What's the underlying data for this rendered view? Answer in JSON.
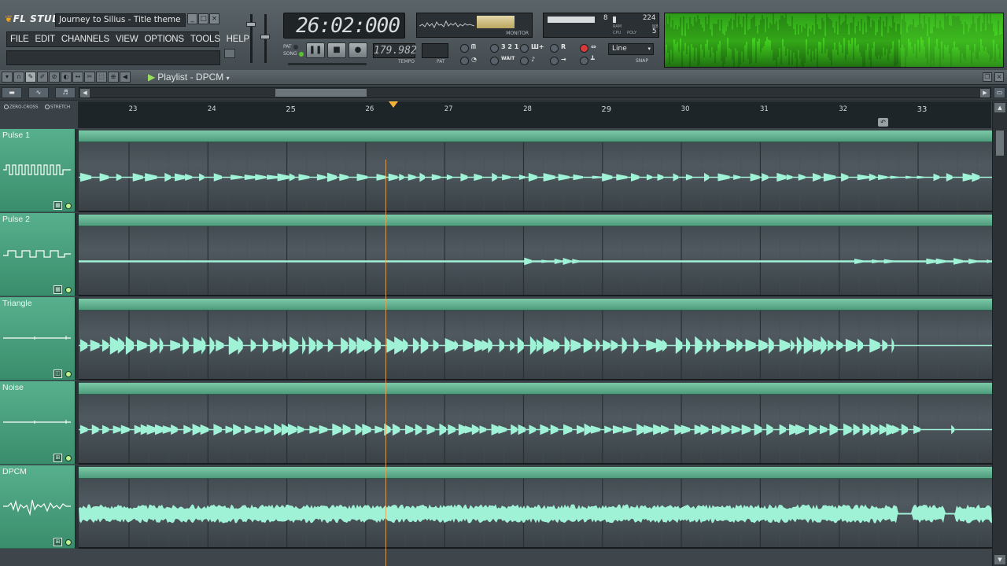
{
  "app": {
    "logo": "FL STUDIO",
    "song_title": "Journey to Silius - Title theme"
  },
  "menu": [
    "FILE",
    "EDIT",
    "CHANNELS",
    "VIEW",
    "OPTIONS",
    "TOOLS",
    "HELP"
  ],
  "window_buttons": [
    "_",
    "□",
    "×"
  ],
  "transport": {
    "time": "26:02:000",
    "pat_label": "PAT",
    "song_label": "SONG",
    "tempo": "179.982",
    "tempo_label": "TEMPO",
    "pat_box_label": "PAT",
    "buttons": [
      "pause",
      "stop",
      "record"
    ]
  },
  "monitor": {
    "label": "MONITOR"
  },
  "cpu": {
    "value_a": "8",
    "value_b": "224",
    "value_c": "5",
    "ram_label": "RAM",
    "mb_label": "MB",
    "cpu_label": "CPU",
    "poly_label": "POLY"
  },
  "toolbar": {
    "count_text": "3 2 1",
    "wait_text": "WAIT",
    "r_text": "R",
    "snap_value": "Line",
    "snap_label": "SNAP"
  },
  "playlist": {
    "title": "Playlist - DPCM",
    "options": [
      "ZERO-CROSS",
      "STRETCH"
    ],
    "bars": [
      23,
      24,
      25,
      26,
      27,
      28,
      29,
      30,
      31,
      32,
      33
    ],
    "major_bars": [
      25,
      29,
      33
    ],
    "playhead_bar": 26.2,
    "tracks": [
      {
        "name": "Pulse 1",
        "icon": "pulse-wave-icon"
      },
      {
        "name": "Pulse 2",
        "icon": "square-wave-icon"
      },
      {
        "name": "Triangle",
        "icon": "flat-wave-icon"
      },
      {
        "name": "Noise",
        "icon": "flat-wave-icon"
      },
      {
        "name": "DPCM",
        "icon": "noisy-wave-icon"
      }
    ]
  },
  "colors": {
    "track_green": "#4fa37f",
    "wave": "#9ff2d6",
    "playhead": "#f2b23a",
    "spectrum": "#3fd21c"
  }
}
